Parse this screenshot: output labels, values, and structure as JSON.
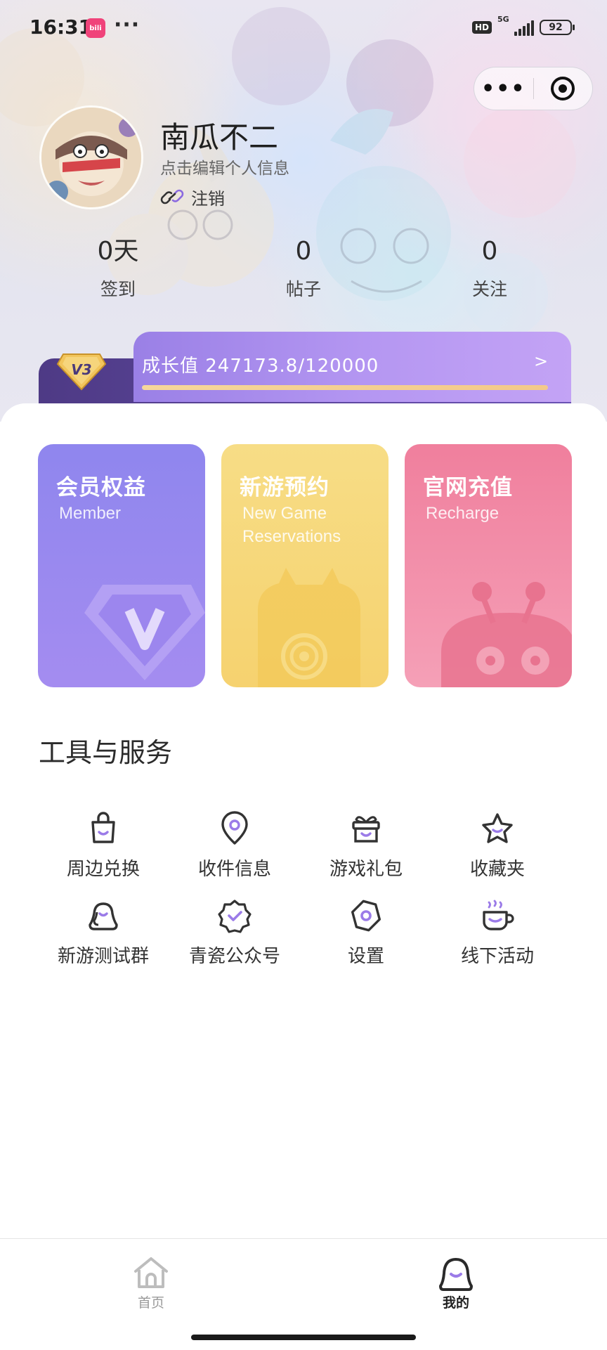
{
  "status_bar": {
    "time": "16:31",
    "more": "···",
    "hd": "HD",
    "network": "5G",
    "battery": "92"
  },
  "capsule": {
    "menu_glyph": "•••"
  },
  "profile": {
    "username": "南瓜不二",
    "edit_hint": "点击编辑个人信息",
    "logout_label": "注销"
  },
  "stats": [
    {
      "value": "0天",
      "label": "签到"
    },
    {
      "value": "0",
      "label": "帖子"
    },
    {
      "value": "0",
      "label": "关注"
    }
  ],
  "growth": {
    "text": "成长值 247173.8/120000",
    "arrow": ">",
    "level_badge": "V3",
    "progress": 1.0
  },
  "cards": [
    {
      "title": "会员权益",
      "subtitle_lines": [
        "Member"
      ],
      "color_top": "#8f86ee",
      "color_bottom": "#a48cf0",
      "icon": "diamond-v-icon"
    },
    {
      "title": "新游预约",
      "subtitle_lines": [
        "New Game",
        "Reservations"
      ],
      "color_top": "#f7dd86",
      "color_bottom": "#f6d26f",
      "icon": "monster-swirl-icon"
    },
    {
      "title": "官网充值",
      "subtitle_lines": [
        "Recharge"
      ],
      "color_top": "#f07f9d",
      "color_bottom": "#f5a0b7",
      "icon": "creature-icon"
    }
  ],
  "tools_section": {
    "title": "工具与服务",
    "items": [
      {
        "label": "周边兑换",
        "icon": "shopping-bag-icon"
      },
      {
        "label": "收件信息",
        "icon": "location-pin-icon"
      },
      {
        "label": "游戏礼包",
        "icon": "gift-icon"
      },
      {
        "label": "收藏夹",
        "icon": "star-icon"
      },
      {
        "label": "新游测试群",
        "icon": "group-icon"
      },
      {
        "label": "青瓷公众号",
        "icon": "verified-badge-icon"
      },
      {
        "label": "设置",
        "icon": "settings-icon"
      },
      {
        "label": "线下活动",
        "icon": "coffee-cup-icon"
      }
    ]
  },
  "bottom_nav": [
    {
      "label": "首页",
      "icon": "home-icon",
      "active": false
    },
    {
      "label": "我的",
      "icon": "profile-icon",
      "active": true
    }
  ],
  "colors": {
    "accent": "#8b6ae0",
    "icon_stroke": "#333333",
    "icon_accent": "#9b7be8",
    "growth_fill": "#f6d79b"
  }
}
